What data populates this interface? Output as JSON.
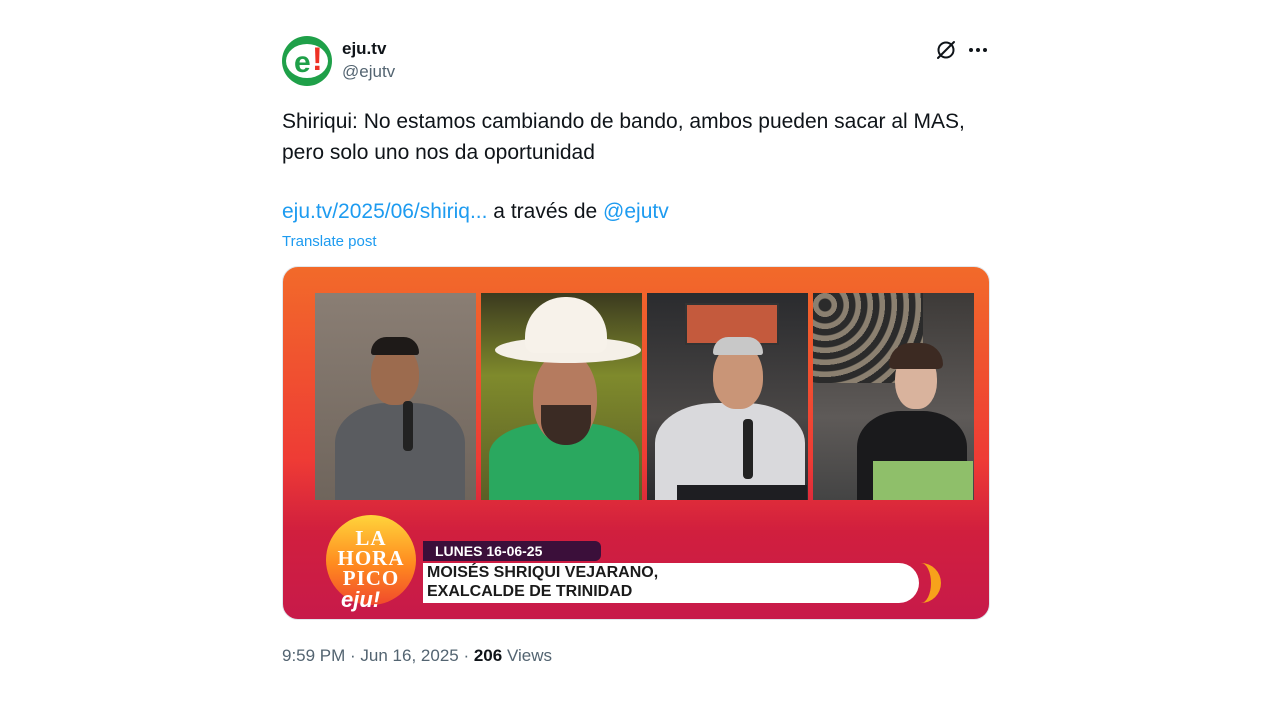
{
  "author": {
    "display_name": "eju.tv",
    "handle": "@ejutv",
    "avatar_letter": "e",
    "avatar_mark": "!",
    "brand_green": "#1fa049",
    "brand_red": "#ee3124"
  },
  "actions": {
    "grok_icon": "grok-icon",
    "more_icon": "more-icon"
  },
  "post": {
    "line1": "Shiriqui: No estamos cambiando de bando, ambos pueden sacar al MAS,",
    "line2": "pero solo uno nos da oportunidad",
    "link_text": "eju.tv/2025/06/shiriq...",
    "via_text": " a través de ",
    "via_handle": "@ejutv",
    "translate_label": "Translate post",
    "link_color": "#1d9bf0"
  },
  "media": {
    "logo_line1": "LA",
    "logo_line2": "HORA",
    "logo_line3": "PICO",
    "logo_brand": "eju!",
    "date_label": "LUNES 16-06-25",
    "name_line1": "MOISÉS SHRIQUI VEJARANO,",
    "name_line2": "EXALCALDE DE TRINIDAD"
  },
  "meta": {
    "time": "9:59 PM",
    "sep1": " · ",
    "date": "Jun 16, 2025",
    "sep2": " · ",
    "views_count": "206",
    "views_label": " Views"
  }
}
